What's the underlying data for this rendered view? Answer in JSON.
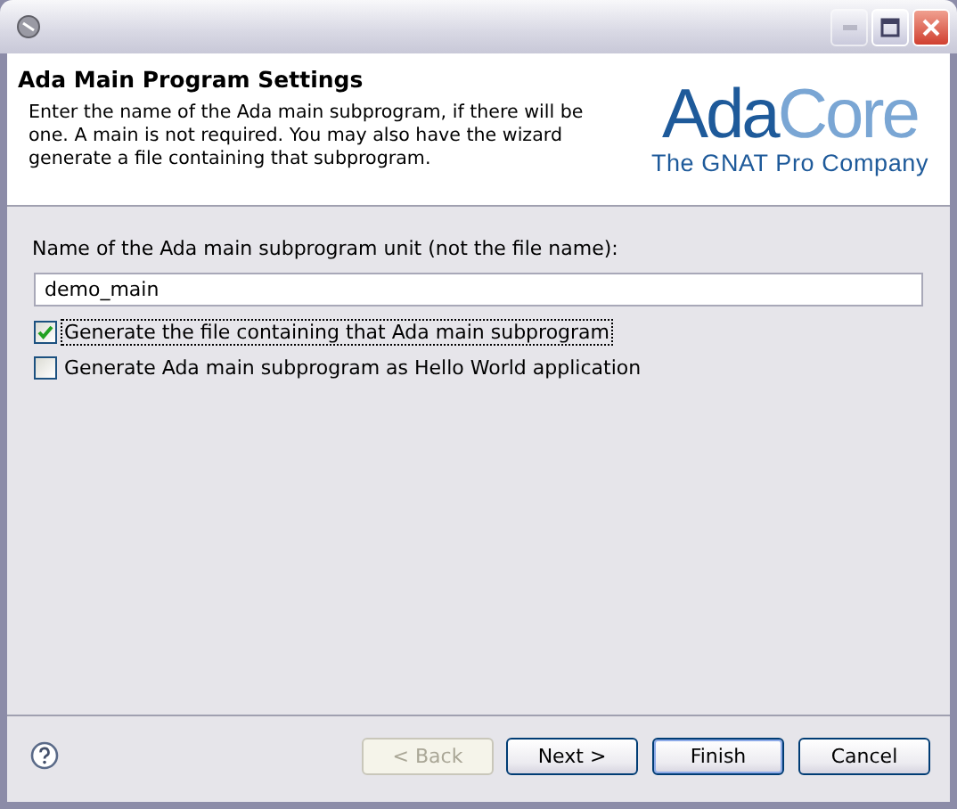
{
  "window": {
    "controls": {
      "minimize_disabled": true
    }
  },
  "header": {
    "title": "Ada Main Program Settings",
    "description": "Enter the name of the Ada main subprogram, if there will be one. A main is not required. You may also have the wizard generate a file containing that subprogram.",
    "logo": {
      "part_1": "Ada",
      "part_2": "Core",
      "tagline": "The GNAT Pro Company"
    }
  },
  "form": {
    "label": "Name of the Ada main subprogram unit (not the file name):",
    "value": "demo_main",
    "checkboxes": [
      {
        "label": "Generate the file containing that Ada main subprogram",
        "checked": true,
        "focused": true
      },
      {
        "label": "Generate Ada main subprogram as Hello World application",
        "checked": false,
        "focused": false
      }
    ]
  },
  "buttons": [
    {
      "label": "< Back",
      "disabled": true,
      "default": false
    },
    {
      "label": "Next >",
      "disabled": false,
      "default": false
    },
    {
      "label": "Finish",
      "disabled": false,
      "default": true
    },
    {
      "label": "Cancel",
      "disabled": false,
      "default": false
    }
  ]
}
